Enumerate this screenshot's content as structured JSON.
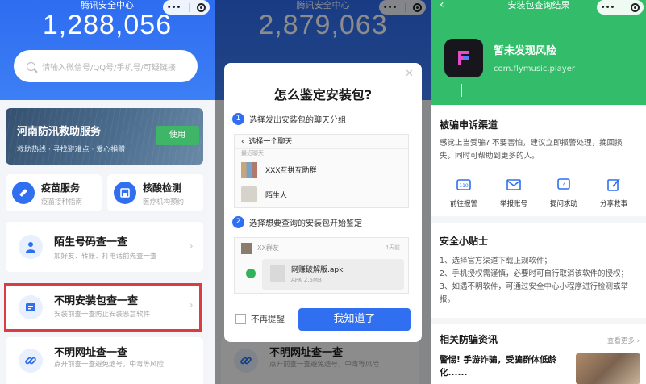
{
  "panel1": {
    "nav_title": "腾讯安全中心",
    "capsule_dots": "•••",
    "big_number": "1,288,056",
    "search_placeholder": "请输入微信号/QQ号/手机号/可疑链接",
    "banner": {
      "title": "河南防汛救助服务",
      "subtitle": "救助热线 · 寻找避难点 · 爱心捐赠",
      "button": "使用"
    },
    "tiles": [
      {
        "title": "疫苗服务",
        "subtitle": "疫苗接种指南"
      },
      {
        "title": "核酸检测",
        "subtitle": "医疗机构预约"
      }
    ],
    "cards": [
      {
        "title": "陌生号码查一查",
        "subtitle": "加好友、转账、打电话前先查一查"
      },
      {
        "title": "不明安装包查一查",
        "subtitle": "安装前查一查防止安装恶意软件"
      },
      {
        "title": "不明网址查一查",
        "subtitle": "点开前查一查避免遗号，中毒等风险"
      }
    ]
  },
  "panel2": {
    "nav_title": "腾讯安全中心",
    "big_number": "2,879,063",
    "modal": {
      "title": "怎么鉴定安装包?",
      "step1": "选择发出安装包的聊天分组",
      "step1_num": "1",
      "choose_chat": "选择一个聊天",
      "recent": "最近聊天",
      "chats": [
        "XXX互拼互助群",
        "陌生人"
      ],
      "step2": "选择想要查询的安装包开始鉴定",
      "step2_num": "2",
      "group_name": "XX群友",
      "msg_time": "4天前",
      "file_name": "网赚破解版.apk",
      "file_size": "APK 2.5MB",
      "no_remind": "不再提醒",
      "ok_button": "我知道了"
    },
    "card_behind": {
      "title": "不明网址查一查",
      "subtitle": "点开前查一查避免遗号，中毒等风险"
    }
  },
  "panel3": {
    "nav_title": "安装包查询结果",
    "result": "暂未发现风险",
    "package": "com.flymusic.player",
    "complaint": {
      "title": "被骗申诉渠道",
      "text": "感觉上当受骗? 不要害怕，建议立即报警处理，挽回损失，同时可帮助到更多的人。",
      "channels": [
        "前往报警",
        "举报账号",
        "提问求助",
        "分享救事"
      ]
    },
    "tips": {
      "title": "安全小贴士",
      "items": [
        "1、选择官方渠道下载正规软件；",
        "2、手机授权需谨慎，必要时可自行取消该软件的授权；",
        "3、如遇不明软件，可通过安全中心小程序进行检测或举报。"
      ]
    },
    "news": {
      "title": "相关防骗资讯",
      "more": "查看更多 ›",
      "headline": "警惕! 手游诈骗，受骗群体低龄化......"
    }
  },
  "colors": {
    "blue": "#2f6ff0",
    "green": "#33bd6a",
    "highlight": "#d93c42"
  }
}
